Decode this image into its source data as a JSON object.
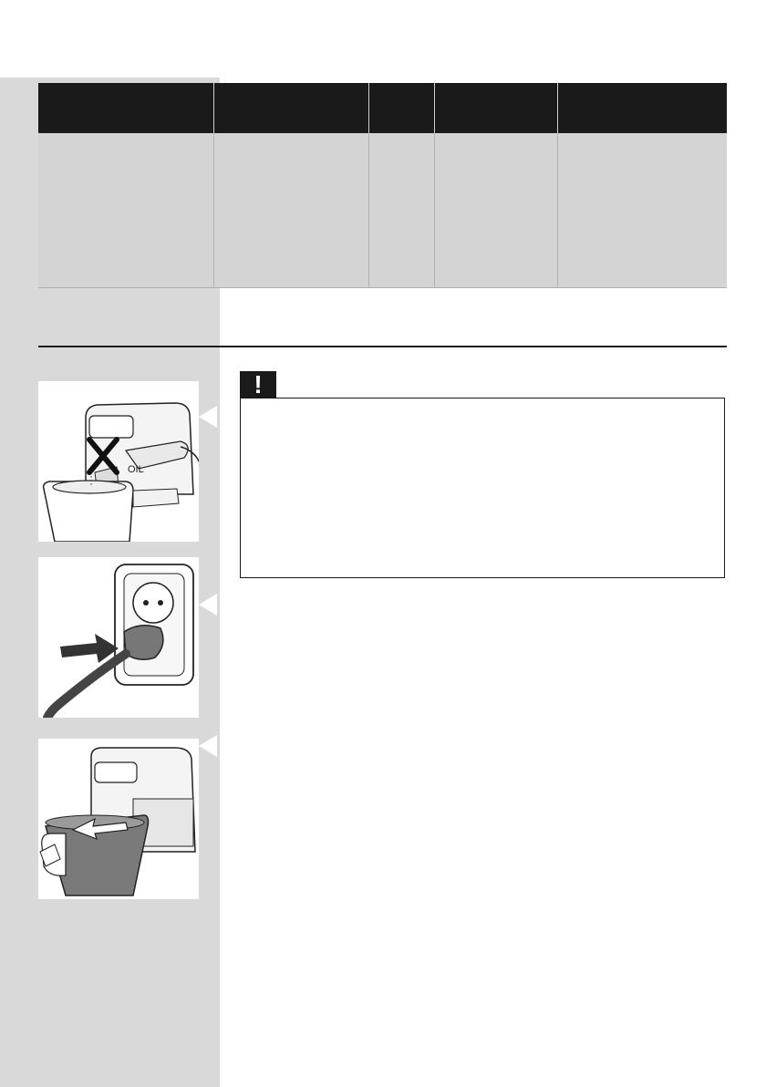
{
  "table": {
    "headers": [
      "",
      "",
      "",
      "",
      ""
    ],
    "row": [
      "",
      "",
      "",
      "",
      ""
    ]
  },
  "warning": {
    "icon": "exclamation-icon",
    "symbol": "!"
  },
  "figures": [
    {
      "name": "no-liquid-in-basket-illustration",
      "icon": "cross-mark"
    },
    {
      "name": "plug-in-socket-illustration",
      "icon": "arrow-right"
    },
    {
      "name": "pull-out-basket-illustration",
      "icon": "arrow-left"
    }
  ],
  "colors": {
    "sidebar": "#d9d9d9",
    "header": "#1a1a1a",
    "cell": "#d4d4d4"
  }
}
